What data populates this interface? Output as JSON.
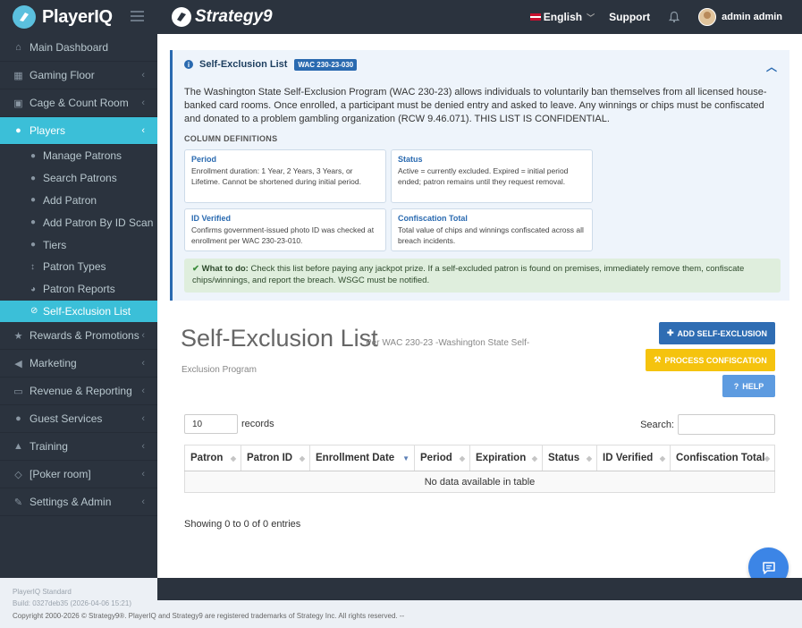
{
  "topbar": {
    "brand": "PlayerIQ",
    "partner": "Strategy9",
    "language": "English",
    "support": "Support",
    "user": "admin admin"
  },
  "sidebar": {
    "items": [
      {
        "label": "Main Dashboard",
        "icon": "home-icon"
      },
      {
        "label": "Gaming Floor",
        "icon": "grid-icon"
      },
      {
        "label": "Cage & Count Room",
        "icon": "lock-icon"
      },
      {
        "label": "Players",
        "icon": "user-icon"
      }
    ],
    "sub_items": [
      {
        "label": "Manage Patrons"
      },
      {
        "label": "Search Patrons"
      },
      {
        "label": "Add Patron"
      },
      {
        "label": "Add Patron By ID Scan"
      },
      {
        "label": "Tiers"
      },
      {
        "label": "Patron Types"
      },
      {
        "label": "Patron Reports"
      },
      {
        "label": "Self-Exclusion List"
      }
    ],
    "items_after": [
      {
        "label": "Rewards & Promotions"
      },
      {
        "label": "Marketing"
      },
      {
        "label": "Revenue & Reporting"
      },
      {
        "label": "Guest Services"
      },
      {
        "label": "Training"
      },
      {
        "label": "[Poker room]"
      },
      {
        "label": "Settings & Admin"
      }
    ],
    "footer_line1": "PlayerIQ Standard",
    "footer_line2": "Build: 0327deb35 (2026-04-06 15:21)"
  },
  "info_panel": {
    "title": "Self-Exclusion List",
    "badge": "WAC 230-23-030",
    "description": "The Washington State Self-Exclusion Program (WAC 230-23) allows individuals to voluntarily ban themselves from all licensed house-banked card rooms. Once enrolled, a participant must be denied entry and asked to leave. Any winnings or chips must be confiscated and donated to a problem gambling organization (RCW 9.46.071). THIS LIST IS CONFIDENTIAL.",
    "column_definitions_heading": "COLUMN DEFINITIONS",
    "definitions": [
      {
        "title": "Period",
        "text": "Enrollment duration: 1 Year, 2 Years, 3 Years, or Lifetime. Cannot be shortened during initial period."
      },
      {
        "title": "Status",
        "text": "Active = currently excluded. Expired = initial period ended; patron remains until they request removal."
      },
      {
        "title": "ID Verified",
        "text": "Confirms government-issued photo ID was checked at enrollment per WAC 230-23-010."
      },
      {
        "title": "Confiscation Total",
        "text": "Total value of chips and winnings confiscated across all breach incidents."
      }
    ],
    "todo_label": "What to do:",
    "todo_text": "Check this list before paying any jackpot prize. If a self-excluded patron is found on premises, immediately remove them, confiscate chips/winnings, and report the breach. WSGC must be notified."
  },
  "page": {
    "title": "Self-Exclusion List",
    "subtitle_part1": "Per WAC 230-23 -Washington State Self-",
    "subtitle_part2": "Exclusion Program"
  },
  "buttons": {
    "add": "ADD SELF-EXCLUSION",
    "process": "PROCESS CONFISCATION",
    "help": "HELP"
  },
  "table": {
    "length_value": "10",
    "length_label": "records",
    "search_label": "Search:",
    "search_value": "",
    "columns": [
      "Patron",
      "Patron ID",
      "Enrollment Date",
      "Period",
      "Expiration",
      "Status",
      "ID Verified",
      "Confiscation Total"
    ],
    "empty_message": "No data available in table",
    "info": "Showing 0 to 0 of 0 entries"
  },
  "footer": {
    "copyright": "Copyright 2000-2026 © Strategy9®. PlayerIQ and Strategy9 are registered trademarks of Strategy Inc. All rights reserved. --"
  }
}
